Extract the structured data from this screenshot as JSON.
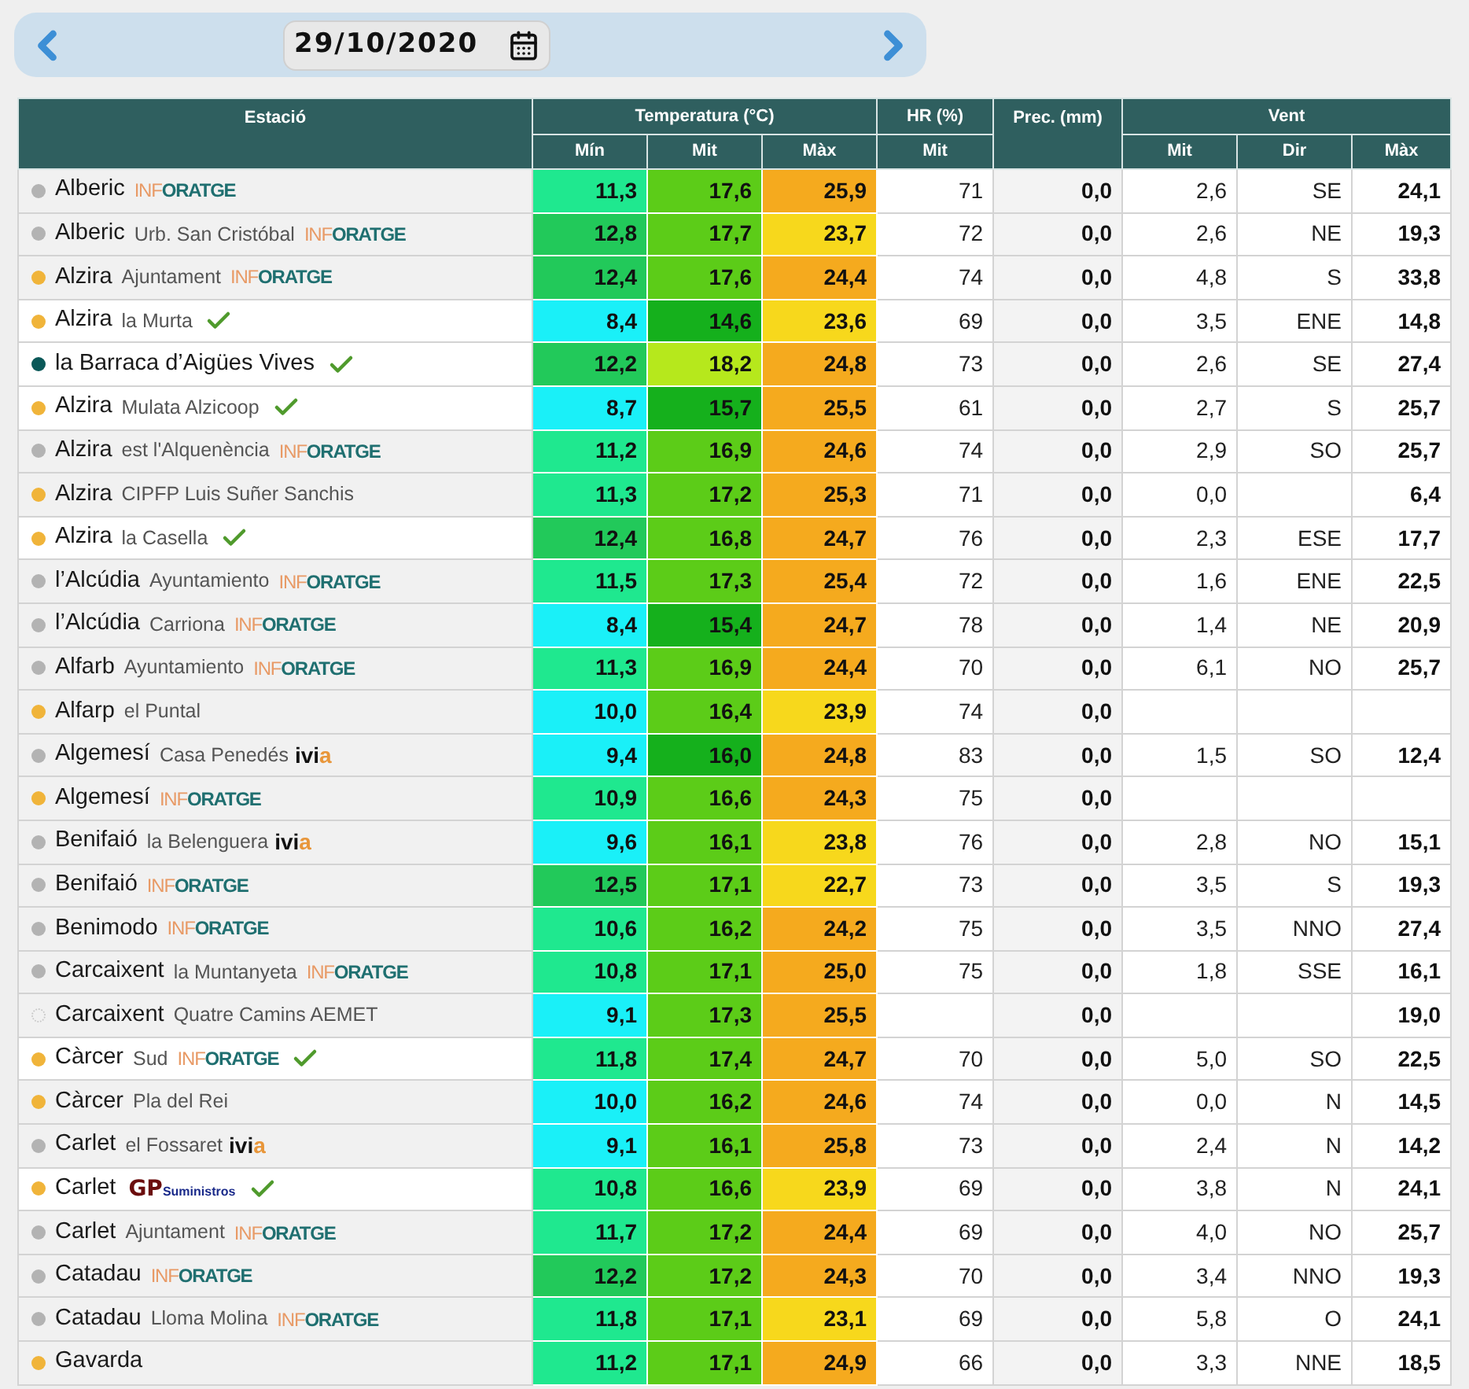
{
  "date_picker": {
    "value": "29/10/2020"
  },
  "table": {
    "groups": [
      {
        "label": "Estació"
      },
      {
        "label": "Temperatura (°C)",
        "columns": [
          "Mín",
          "Mit",
          "Màx"
        ]
      },
      {
        "label": "HR (%)",
        "columns": [
          "Mit"
        ]
      },
      {
        "label": "Prec. (mm)"
      },
      {
        "label": "Vent",
        "columns": [
          "Mit",
          "Dir",
          "Màx"
        ]
      }
    ],
    "rows": [
      {
        "place": "Alberic",
        "source": {
          "kind": "inforatge",
          "parts": [
            "INF",
            "ORATGE"
          ]
        },
        "verified": false,
        "dot": {
          "color": "#b3b3b3",
          "kind": "filled"
        },
        "t_min": {
          "value": "11,3",
          "color": "#1fe88f"
        },
        "t_mit": {
          "value": "17,6",
          "color": "#5ccc18"
        },
        "t_max": {
          "value": "25,9",
          "color": "#f5aa1e"
        },
        "hr": "71",
        "prec": "0,0",
        "wind_mit": "2,6",
        "wind_dir": "SE",
        "wind_max": "24,1"
      },
      {
        "place": "Alberic",
        "detail": "Urb. San Cristóbal",
        "source": {
          "kind": "inforatge",
          "parts": [
            "INF",
            "ORATGE"
          ]
        },
        "verified": false,
        "dot": {
          "color": "#b3b3b3",
          "kind": "filled"
        },
        "t_min": {
          "value": "12,8",
          "color": "#22c95a"
        },
        "t_mit": {
          "value": "17,7",
          "color": "#5ccc18"
        },
        "t_max": {
          "value": "23,7",
          "color": "#f7d81c"
        },
        "hr": "72",
        "prec": "0,0",
        "wind_mit": "2,6",
        "wind_dir": "NE",
        "wind_max": "19,3"
      },
      {
        "place": "Alzira",
        "detail": "Ajuntament",
        "source": {
          "kind": "inforatge",
          "parts": [
            "INF",
            "ORATGE"
          ]
        },
        "verified": false,
        "dot": {
          "color": "#f0b43a",
          "kind": "filled"
        },
        "t_min": {
          "value": "12,4",
          "color": "#22c95a"
        },
        "t_mit": {
          "value": "17,6",
          "color": "#5ccc18"
        },
        "t_max": {
          "value": "24,4",
          "color": "#f5aa1e"
        },
        "hr": "74",
        "prec": "0,0",
        "wind_mit": "4,8",
        "wind_dir": "S",
        "wind_max": "33,8"
      },
      {
        "place": "Alzira",
        "detail": "la Murta",
        "verified": true,
        "dot": {
          "color": "#f0b43a",
          "kind": "filled"
        },
        "t_min": {
          "value": "8,4",
          "color": "#1af0f8"
        },
        "t_mit": {
          "value": "14,6",
          "color": "#15b01c"
        },
        "t_max": {
          "value": "23,6",
          "color": "#f7d81c"
        },
        "hr": "69",
        "prec": "0,0",
        "wind_mit": "3,5",
        "wind_dir": "ENE",
        "wind_max": "14,8"
      },
      {
        "place": "la Barraca d’Aigües Vives",
        "verified": true,
        "dot": {
          "color": "#0a5858",
          "kind": "filled"
        },
        "t_min": {
          "value": "12,2",
          "color": "#22c95a"
        },
        "t_mit": {
          "value": "18,2",
          "color": "#b6e81c"
        },
        "t_max": {
          "value": "24,8",
          "color": "#f5aa1e"
        },
        "hr": "73",
        "prec": "0,0",
        "wind_mit": "2,6",
        "wind_dir": "SE",
        "wind_max": "27,4"
      },
      {
        "place": "Alzira",
        "detail": "Mulata Alzicoop",
        "verified": true,
        "dot": {
          "color": "#f0b43a",
          "kind": "filled"
        },
        "t_min": {
          "value": "8,7",
          "color": "#1af0f8"
        },
        "t_mit": {
          "value": "15,7",
          "color": "#15b01c"
        },
        "t_max": {
          "value": "25,5",
          "color": "#f5aa1e"
        },
        "hr": "61",
        "prec": "0,0",
        "wind_mit": "2,7",
        "wind_dir": "S",
        "wind_max": "25,7"
      },
      {
        "place": "Alzira",
        "detail": "est l'Alquenència",
        "source": {
          "kind": "inforatge",
          "parts": [
            "INF",
            "ORATGE"
          ]
        },
        "verified": false,
        "dot": {
          "color": "#b3b3b3",
          "kind": "filled"
        },
        "t_min": {
          "value": "11,2",
          "color": "#1fe88f"
        },
        "t_mit": {
          "value": "16,9",
          "color": "#5ccc18"
        },
        "t_max": {
          "value": "24,6",
          "color": "#f5aa1e"
        },
        "hr": "74",
        "prec": "0,0",
        "wind_mit": "2,9",
        "wind_dir": "SO",
        "wind_max": "25,7"
      },
      {
        "place": "Alzira",
        "detail": "CIPFP Luis Suñer Sanchis",
        "verified": false,
        "dot": {
          "color": "#f0b43a",
          "kind": "filled"
        },
        "t_min": {
          "value": "11,3",
          "color": "#1fe88f"
        },
        "t_mit": {
          "value": "17,2",
          "color": "#5ccc18"
        },
        "t_max": {
          "value": "25,3",
          "color": "#f5aa1e"
        },
        "hr": "71",
        "prec": "0,0",
        "wind_mit": "0,0",
        "wind_max": "6,4"
      },
      {
        "place": "Alzira",
        "detail": "la Casella",
        "verified": true,
        "dot": {
          "color": "#f0b43a",
          "kind": "filled"
        },
        "t_min": {
          "value": "12,4",
          "color": "#22c95a"
        },
        "t_mit": {
          "value": "16,8",
          "color": "#5ccc18"
        },
        "t_max": {
          "value": "24,7",
          "color": "#f5aa1e"
        },
        "hr": "76",
        "prec": "0,0",
        "wind_mit": "2,3",
        "wind_dir": "ESE",
        "wind_max": "17,7"
      },
      {
        "place": "l’Alcúdia",
        "detail": "Ayuntamiento",
        "source": {
          "kind": "inforatge",
          "parts": [
            "INF",
            "ORATGE"
          ]
        },
        "verified": false,
        "dot": {
          "color": "#b3b3b3",
          "kind": "filled"
        },
        "t_min": {
          "value": "11,5",
          "color": "#1fe88f"
        },
        "t_mit": {
          "value": "17,3",
          "color": "#5ccc18"
        },
        "t_max": {
          "value": "25,4",
          "color": "#f5aa1e"
        },
        "hr": "72",
        "prec": "0,0",
        "wind_mit": "1,6",
        "wind_dir": "ENE",
        "wind_max": "22,5"
      },
      {
        "place": "l’Alcúdia",
        "detail": "Carriona",
        "source": {
          "kind": "inforatge",
          "parts": [
            "INF",
            "ORATGE"
          ]
        },
        "verified": false,
        "dot": {
          "color": "#b3b3b3",
          "kind": "filled"
        },
        "t_min": {
          "value": "8,4",
          "color": "#1af0f8"
        },
        "t_mit": {
          "value": "15,4",
          "color": "#15b01c"
        },
        "t_max": {
          "value": "24,7",
          "color": "#f5aa1e"
        },
        "hr": "78",
        "prec": "0,0",
        "wind_mit": "1,4",
        "wind_dir": "NE",
        "wind_max": "20,9"
      },
      {
        "place": "Alfarb",
        "detail": "Ayuntamiento",
        "source": {
          "kind": "inforatge",
          "parts": [
            "INF",
            "ORATGE"
          ]
        },
        "verified": false,
        "dot": {
          "color": "#b3b3b3",
          "kind": "filled"
        },
        "t_min": {
          "value": "11,3",
          "color": "#1fe88f"
        },
        "t_mit": {
          "value": "16,9",
          "color": "#5ccc18"
        },
        "t_max": {
          "value": "24,4",
          "color": "#f5aa1e"
        },
        "hr": "70",
        "prec": "0,0",
        "wind_mit": "6,1",
        "wind_dir": "NO",
        "wind_max": "25,7"
      },
      {
        "place": "Alfarp",
        "detail": "el Puntal",
        "verified": false,
        "dot": {
          "color": "#f0b43a",
          "kind": "filled"
        },
        "t_min": {
          "value": "10,0",
          "color": "#1af0f8"
        },
        "t_mit": {
          "value": "16,4",
          "color": "#5ccc18"
        },
        "t_max": {
          "value": "23,9",
          "color": "#f7d81c"
        },
        "hr": "74",
        "prec": "0,0"
      },
      {
        "place": "Algemesí",
        "detail": "Casa Penedés",
        "source": {
          "kind": "ivia",
          "parts": [
            "ivi",
            "a"
          ]
        },
        "verified": false,
        "dot": {
          "color": "#b3b3b3",
          "kind": "filled"
        },
        "t_min": {
          "value": "9,4",
          "color": "#1af0f8"
        },
        "t_mit": {
          "value": "16,0",
          "color": "#15b01c"
        },
        "t_max": {
          "value": "24,8",
          "color": "#f5aa1e"
        },
        "hr": "83",
        "prec": "0,0",
        "wind_mit": "1,5",
        "wind_dir": "SO",
        "wind_max": "12,4"
      },
      {
        "place": "Algemesí",
        "source": {
          "kind": "inforatge",
          "parts": [
            "INF",
            "ORATGE"
          ]
        },
        "verified": false,
        "dot": {
          "color": "#f0b43a",
          "kind": "filled"
        },
        "t_min": {
          "value": "10,9",
          "color": "#1fe88f"
        },
        "t_mit": {
          "value": "16,6",
          "color": "#5ccc18"
        },
        "t_max": {
          "value": "24,3",
          "color": "#f5aa1e"
        },
        "hr": "75",
        "prec": "0,0"
      },
      {
        "place": "Benifaió",
        "detail": "la Belenguera",
        "source": {
          "kind": "ivia",
          "parts": [
            "ivi",
            "a"
          ]
        },
        "verified": false,
        "dot": {
          "color": "#b3b3b3",
          "kind": "filled"
        },
        "t_min": {
          "value": "9,6",
          "color": "#1af0f8"
        },
        "t_mit": {
          "value": "16,1",
          "color": "#5ccc18"
        },
        "t_max": {
          "value": "23,8",
          "color": "#f7d81c"
        },
        "hr": "76",
        "prec": "0,0",
        "wind_mit": "2,8",
        "wind_dir": "NO",
        "wind_max": "15,1"
      },
      {
        "place": "Benifaió",
        "source": {
          "kind": "inforatge",
          "parts": [
            "INF",
            "ORATGE"
          ]
        },
        "verified": false,
        "dot": {
          "color": "#b3b3b3",
          "kind": "filled"
        },
        "t_min": {
          "value": "12,5",
          "color": "#22c95a"
        },
        "t_mit": {
          "value": "17,1",
          "color": "#5ccc18"
        },
        "t_max": {
          "value": "22,7",
          "color": "#f7d81c"
        },
        "hr": "73",
        "prec": "0,0",
        "wind_mit": "3,5",
        "wind_dir": "S",
        "wind_max": "19,3"
      },
      {
        "place": "Benimodo",
        "source": {
          "kind": "inforatge",
          "parts": [
            "INF",
            "ORATGE"
          ]
        },
        "verified": false,
        "dot": {
          "color": "#b3b3b3",
          "kind": "filled"
        },
        "t_min": {
          "value": "10,6",
          "color": "#1fe88f"
        },
        "t_mit": {
          "value": "16,2",
          "color": "#5ccc18"
        },
        "t_max": {
          "value": "24,2",
          "color": "#f5aa1e"
        },
        "hr": "75",
        "prec": "0,0",
        "wind_mit": "3,5",
        "wind_dir": "NNO",
        "wind_max": "27,4"
      },
      {
        "place": "Carcaixent",
        "detail": "la Muntanyeta",
        "source": {
          "kind": "inforatge",
          "parts": [
            "INF",
            "ORATGE"
          ]
        },
        "verified": false,
        "dot": {
          "color": "#b3b3b3",
          "kind": "filled"
        },
        "t_min": {
          "value": "10,8",
          "color": "#1fe88f"
        },
        "t_mit": {
          "value": "17,1",
          "color": "#5ccc18"
        },
        "t_max": {
          "value": "25,0",
          "color": "#f5aa1e"
        },
        "hr": "75",
        "prec": "0,0",
        "wind_mit": "1,8",
        "wind_dir": "SSE",
        "wind_max": "16,1"
      },
      {
        "place": "Carcaixent",
        "detail": "Quatre Camins AEMET",
        "verified": false,
        "dot": {
          "color": "#c8c8c8",
          "kind": "hollow"
        },
        "t_min": {
          "value": "9,1",
          "color": "#1af0f8"
        },
        "t_mit": {
          "value": "17,3",
          "color": "#5ccc18"
        },
        "t_max": {
          "value": "25,5",
          "color": "#f5aa1e"
        },
        "prec": "0,0",
        "wind_max": "19,0"
      },
      {
        "place": "Càrcer",
        "detail": "Sud",
        "source": {
          "kind": "inforatge",
          "parts": [
            "INF",
            "ORATGE"
          ]
        },
        "verified": true,
        "dot": {
          "color": "#f0b43a",
          "kind": "filled"
        },
        "t_min": {
          "value": "11,8",
          "color": "#1fe88f"
        },
        "t_mit": {
          "value": "17,4",
          "color": "#5ccc18"
        },
        "t_max": {
          "value": "24,7",
          "color": "#f5aa1e"
        },
        "hr": "70",
        "prec": "0,0",
        "wind_mit": "5,0",
        "wind_dir": "SO",
        "wind_max": "22,5"
      },
      {
        "place": "Càrcer",
        "detail": "Pla del Rei",
        "verified": false,
        "dot": {
          "color": "#f0b43a",
          "kind": "filled"
        },
        "t_min": {
          "value": "10,0",
          "color": "#1af0f8"
        },
        "t_mit": {
          "value": "16,2",
          "color": "#5ccc18"
        },
        "t_max": {
          "value": "24,6",
          "color": "#f5aa1e"
        },
        "hr": "74",
        "prec": "0,0",
        "wind_mit": "0,0",
        "wind_dir": "N",
        "wind_max": "14,5"
      },
      {
        "place": "Carlet",
        "detail": "el Fossaret",
        "source": {
          "kind": "ivia",
          "parts": [
            "ivi",
            "a"
          ]
        },
        "verified": false,
        "dot": {
          "color": "#b3b3b3",
          "kind": "filled"
        },
        "t_min": {
          "value": "9,1",
          "color": "#1af0f8"
        },
        "t_mit": {
          "value": "16,1",
          "color": "#5ccc18"
        },
        "t_max": {
          "value": "25,8",
          "color": "#f5aa1e"
        },
        "hr": "73",
        "prec": "0,0",
        "wind_mit": "2,4",
        "wind_dir": "N",
        "wind_max": "14,2"
      },
      {
        "place": "Carlet",
        "source": {
          "kind": "gp",
          "parts": [
            "GP",
            "Suministros"
          ]
        },
        "verified": true,
        "dot": {
          "color": "#f0b43a",
          "kind": "filled"
        },
        "t_min": {
          "value": "10,8",
          "color": "#1fe88f"
        },
        "t_mit": {
          "value": "16,6",
          "color": "#5ccc18"
        },
        "t_max": {
          "value": "23,9",
          "color": "#f7d81c"
        },
        "hr": "69",
        "prec": "0,0",
        "wind_mit": "3,8",
        "wind_dir": "N",
        "wind_max": "24,1"
      },
      {
        "place": "Carlet",
        "detail": "Ajuntament",
        "source": {
          "kind": "inforatge",
          "parts": [
            "INF",
            "ORATGE"
          ]
        },
        "verified": false,
        "dot": {
          "color": "#b3b3b3",
          "kind": "filled"
        },
        "t_min": {
          "value": "11,7",
          "color": "#1fe88f"
        },
        "t_mit": {
          "value": "17,2",
          "color": "#5ccc18"
        },
        "t_max": {
          "value": "24,4",
          "color": "#f5aa1e"
        },
        "hr": "69",
        "prec": "0,0",
        "wind_mit": "4,0",
        "wind_dir": "NO",
        "wind_max": "25,7"
      },
      {
        "place": "Catadau",
        "source": {
          "kind": "inforatge",
          "parts": [
            "INF",
            "ORATGE"
          ]
        },
        "verified": false,
        "dot": {
          "color": "#b3b3b3",
          "kind": "filled"
        },
        "t_min": {
          "value": "12,2",
          "color": "#22c95a"
        },
        "t_mit": {
          "value": "17,2",
          "color": "#5ccc18"
        },
        "t_max": {
          "value": "24,3",
          "color": "#f5aa1e"
        },
        "hr": "70",
        "prec": "0,0",
        "wind_mit": "3,4",
        "wind_dir": "NNO",
        "wind_max": "19,3"
      },
      {
        "place": "Catadau",
        "detail": "Lloma Molina",
        "source": {
          "kind": "inforatge",
          "parts": [
            "INF",
            "ORATGE"
          ]
        },
        "verified": false,
        "dot": {
          "color": "#b3b3b3",
          "kind": "filled"
        },
        "t_min": {
          "value": "11,8",
          "color": "#1fe88f"
        },
        "t_mit": {
          "value": "17,1",
          "color": "#5ccc18"
        },
        "t_max": {
          "value": "23,1",
          "color": "#f7d81c"
        },
        "hr": "69",
        "prec": "0,0",
        "wind_mit": "5,8",
        "wind_dir": "O",
        "wind_max": "24,1"
      },
      {
        "place": "Gavarda",
        "verified": false,
        "dot": {
          "color": "#f0b43a",
          "kind": "filled"
        },
        "t_min": {
          "value": "11,2",
          "color": "#1fe88f"
        },
        "t_mit": {
          "value": "17,1",
          "color": "#5ccc18"
        },
        "t_max": {
          "value": "24,9",
          "color": "#f5aa1e"
        },
        "hr": "66",
        "prec": "0,0",
        "wind_mit": "3,3",
        "wind_dir": "NNE",
        "wind_max": "18,5"
      }
    ]
  }
}
